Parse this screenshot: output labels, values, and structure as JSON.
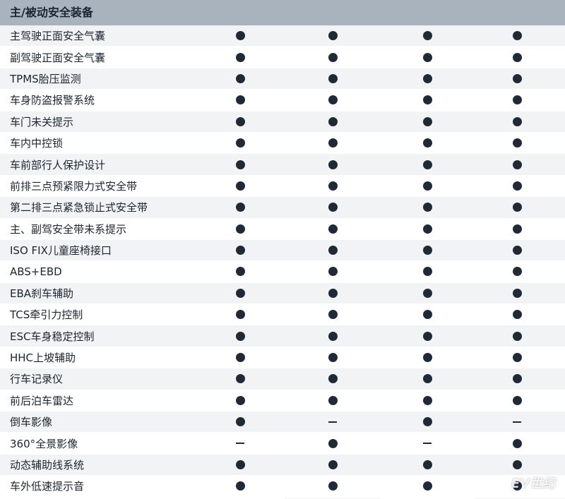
{
  "section_title": "主/被动安全装备",
  "watermark": "EV世纪",
  "rows": [
    {
      "label": "主驾驶正面安全气囊",
      "values": [
        "dot",
        "dot",
        "dot",
        "dot"
      ]
    },
    {
      "label": "副驾驶正面安全气囊",
      "values": [
        "dot",
        "dot",
        "dot",
        "dot"
      ]
    },
    {
      "label": "TPMS胎压监测",
      "values": [
        "dot",
        "dot",
        "dot",
        "dot"
      ]
    },
    {
      "label": "车身防盗报警系统",
      "values": [
        "dot",
        "dot",
        "dot",
        "dot"
      ]
    },
    {
      "label": "车门未关提示",
      "values": [
        "dot",
        "dot",
        "dot",
        "dot"
      ]
    },
    {
      "label": "车内中控锁",
      "values": [
        "dot",
        "dot",
        "dot",
        "dot"
      ]
    },
    {
      "label": "车前部行人保护设计",
      "values": [
        "dot",
        "dot",
        "dot",
        "dot"
      ]
    },
    {
      "label": "前排三点预紧限力式安全带",
      "values": [
        "dot",
        "dot",
        "dot",
        "dot"
      ]
    },
    {
      "label": "第二排三点紧急锁止式安全带",
      "values": [
        "dot",
        "dot",
        "dot",
        "dot"
      ]
    },
    {
      "label": "主、副驾安全带未系提示",
      "values": [
        "dot",
        "dot",
        "dot",
        "dot"
      ]
    },
    {
      "label": "ISO FIX儿童座椅接口",
      "values": [
        "dot",
        "dot",
        "dot",
        "dot"
      ]
    },
    {
      "label": "ABS+EBD",
      "values": [
        "dot",
        "dot",
        "dot",
        "dot"
      ]
    },
    {
      "label": "EBA刹车辅助",
      "values": [
        "dot",
        "dot",
        "dot",
        "dot"
      ]
    },
    {
      "label": "TCS牵引力控制",
      "values": [
        "dot",
        "dot",
        "dot",
        "dot"
      ]
    },
    {
      "label": "ESC车身稳定控制",
      "values": [
        "dot",
        "dot",
        "dot",
        "dot"
      ]
    },
    {
      "label": "HHC上坡辅助",
      "values": [
        "dot",
        "dot",
        "dot",
        "dot"
      ]
    },
    {
      "label": "行车记录仪",
      "values": [
        "dot",
        "dot",
        "dot",
        "dot"
      ]
    },
    {
      "label": "前后泊车雷达",
      "values": [
        "dot",
        "dot",
        "dot",
        "dot"
      ]
    },
    {
      "label": "倒车影像",
      "values": [
        "dot",
        "dash",
        "dot",
        "dash"
      ]
    },
    {
      "label": "360°全景影像",
      "values": [
        "dash",
        "dot",
        "dash",
        "dot"
      ]
    },
    {
      "label": "动态辅助线系统",
      "values": [
        "dot",
        "dot",
        "dot",
        "dot"
      ]
    },
    {
      "label": "车外低速提示音",
      "values": [
        "dot",
        "dot",
        "dot",
        "dot"
      ]
    }
  ]
}
